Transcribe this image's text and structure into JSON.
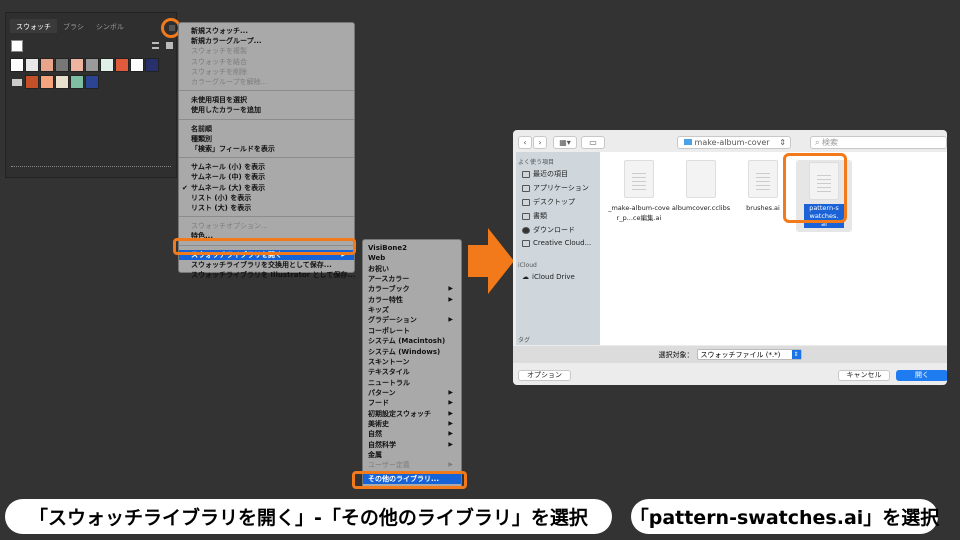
{
  "panel": {
    "tabs": [
      "スウォッチ",
      "ブラシ",
      "シンボル"
    ],
    "swatch_row1": [
      "#ffffff",
      "#e8e8e8",
      "#e9a58a",
      "#777777",
      "#efb4a0",
      "#9a9a9a",
      "#dff0e8",
      "#e05a3c",
      "#ffffff",
      "#27306b"
    ],
    "swatch_row2": [
      "#c4502a",
      "#f6a47e",
      "#e8e0cc",
      "#7fbea2",
      "#2b4592"
    ]
  },
  "menu": {
    "items": [
      {
        "label": "新規スウォッチ...",
        "state": "normal"
      },
      {
        "label": "新規カラーグループ...",
        "state": "normal"
      },
      {
        "label": "スウォッチを複製",
        "state": "disabled"
      },
      {
        "label": "スウォッチを結合",
        "state": "disabled"
      },
      {
        "label": "スウォッチを削除",
        "state": "disabled"
      },
      {
        "label": "カラーグループを解除...",
        "state": "disabled"
      },
      {
        "label": "未使用項目を選択",
        "state": "normal"
      },
      {
        "label": "使用したカラーを追加",
        "state": "normal"
      },
      {
        "label": "名前順",
        "state": "normal"
      },
      {
        "label": "種類別",
        "state": "normal"
      },
      {
        "label": "「検索」フィールドを表示",
        "state": "normal"
      },
      {
        "label": "サムネール (小) を表示",
        "state": "normal"
      },
      {
        "label": "サムネール (中) を表示",
        "state": "normal"
      },
      {
        "label": "サムネール (大) を表示",
        "state": "checked"
      },
      {
        "label": "リスト (小) を表示",
        "state": "normal"
      },
      {
        "label": "リスト (大) を表示",
        "state": "normal"
      },
      {
        "label": "スウォッチオプション...",
        "state": "disabled"
      },
      {
        "label": "特色...",
        "state": "normal"
      },
      {
        "label": "スウォッチライブラリを開く",
        "state": "highlighted",
        "submenu": true
      },
      {
        "label": "スウォッチライブラリを交換用として保存...",
        "state": "normal"
      },
      {
        "label": "スウォッチライブラリを Illustrator として保存...",
        "state": "normal"
      }
    ]
  },
  "submenu": {
    "items": [
      {
        "label": "VisiBone2"
      },
      {
        "label": "Web"
      },
      {
        "label": "お祝い"
      },
      {
        "label": "アースカラー"
      },
      {
        "label": "カラーブック",
        "submenu": true
      },
      {
        "label": "カラー特性",
        "submenu": true
      },
      {
        "label": "キッズ"
      },
      {
        "label": "グラデーション",
        "submenu": true
      },
      {
        "label": "コーポレート"
      },
      {
        "label": "システム (Macintosh)"
      },
      {
        "label": "システム (Windows)"
      },
      {
        "label": "スキントーン"
      },
      {
        "label": "テキスタイル"
      },
      {
        "label": "ニュートラル"
      },
      {
        "label": "パターン",
        "submenu": true
      },
      {
        "label": "フード",
        "submenu": true
      },
      {
        "label": "初期設定スウォッチ",
        "submenu": true
      },
      {
        "label": "美術史",
        "submenu": true
      },
      {
        "label": "自然",
        "submenu": true
      },
      {
        "label": "自然科学",
        "submenu": true
      },
      {
        "label": "金属"
      },
      {
        "label": "ユーザー定義",
        "submenu": true,
        "disabled": true
      },
      {
        "label": "その他のライブラリ...",
        "highlighted": true
      }
    ]
  },
  "dialog": {
    "folder": "make-album-cover",
    "search_placeholder": "検索",
    "sidebar": {
      "favorites_header": "よく使う項目",
      "favorites": [
        "最近の項目",
        "アプリケーション",
        "デスクトップ",
        "書類",
        "ダウンロード",
        "Creative Cloud..."
      ],
      "icloud_header": "iCloud",
      "icloud": [
        "iCloud Drive"
      ],
      "tags_header": "タグ"
    },
    "files": [
      {
        "name": "_make-album-cover_p...ce編集.ai"
      },
      {
        "name": "albumcover.cclibs"
      },
      {
        "name": "brushes.ai"
      },
      {
        "name": "pattern-swatches.ai",
        "selected": true
      }
    ],
    "filter_label": "選択対象：",
    "filter_value": "スウォッチファイル (*.*)",
    "options_button": "オプション",
    "cancel_button": "キャンセル",
    "open_button": "開く"
  },
  "captions": {
    "left": "「スウォッチライブラリを開く」-「その他のライブラリ」を選択",
    "right": "「pattern-swatches.ai」を選択"
  },
  "colors": {
    "accent": "#f27a1a",
    "highlight": "#1563d6"
  }
}
